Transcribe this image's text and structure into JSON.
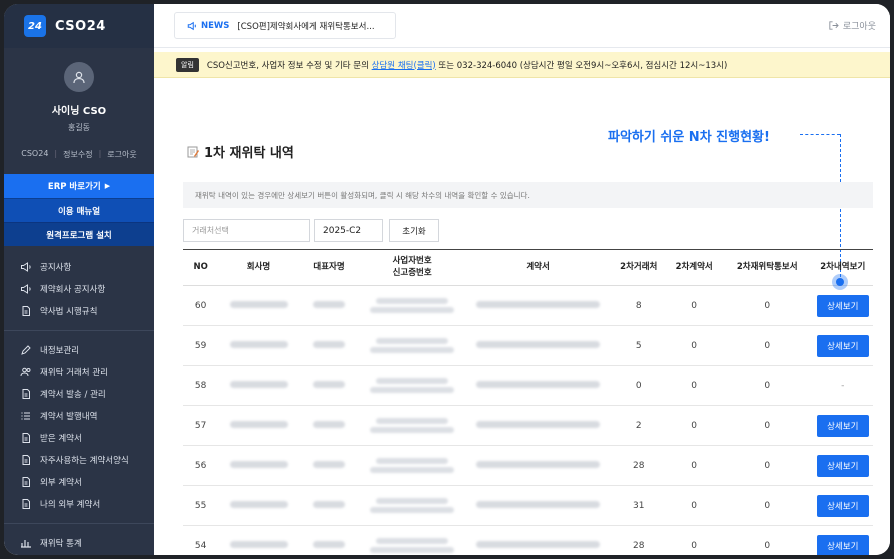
{
  "brand": {
    "logo": "24",
    "name": "CSO24"
  },
  "profile": {
    "name": "사이닝 CSO",
    "sub": "홍길동",
    "links": [
      "CSO24",
      "정보수정",
      "로그아웃"
    ]
  },
  "sidebar_buttons": {
    "erp": "ERP 바로가기",
    "manual": "이용 매뉴얼",
    "remote": "원격프로그램 설치"
  },
  "menu_group1": [
    {
      "label": "공지사항",
      "icon": "megaphone-icon"
    },
    {
      "label": "제약회사 공지사항",
      "icon": "megaphone-icon"
    },
    {
      "label": "약사법 시행규칙",
      "icon": "document-icon"
    }
  ],
  "menu_group2": [
    {
      "label": "내정보관리",
      "icon": "pencil-icon"
    },
    {
      "label": "재위탁 거래처 관리",
      "icon": "users-icon"
    },
    {
      "label": "계약서 발송 / 관리",
      "icon": "document-icon"
    },
    {
      "label": "계약서 발행내역",
      "icon": "list-icon"
    },
    {
      "label": "받은 계약서",
      "icon": "document-icon"
    },
    {
      "label": "자주사용하는 계약서양식",
      "icon": "document-icon"
    },
    {
      "label": "외부 계약서",
      "icon": "document-icon"
    },
    {
      "label": "나의 외부 계약서",
      "icon": "document-icon"
    }
  ],
  "menu_group3": [
    {
      "label": "재위탁 통계",
      "icon": "chart-icon"
    }
  ],
  "topbar": {
    "news_tag": "NEWS",
    "news_text": "[CSO편]제약회사에게 재위탁통보서...",
    "logout": "로그아웃"
  },
  "notice": {
    "badge": "알림",
    "text_before": "CSO신고번호, 사업자 정보 수정 및 기타 문의 ",
    "link": "상담원 채팅(클릭)",
    "text_after": " 또는 032-324-6040 (상담시간 평일 오전9시~오후6시, 점심시간 12시~13시)"
  },
  "callout": "파악하기 쉬운 N차 진행현황!",
  "page": {
    "title": "1차 재위탁 내역",
    "description": "재위탁 내역이 있는 경우에만 상세보기 버튼이 활성화되며, 클릭 시 해당 차수의 내역을 확인할 수 있습니다.",
    "filter_select_placeholder": "거래처선택",
    "filter_year": "2025-C2",
    "reset_label": "초기화"
  },
  "table": {
    "headers": {
      "no": "NO",
      "company": "회사명",
      "rep": "대표자명",
      "biz_line1": "사업자번호",
      "biz_line2": "신고증번호",
      "contract": "계약서",
      "n2_clients": "2차거래처",
      "n2_contracts": "2차계약서",
      "n2_notices": "2차재위탁통보서",
      "n2_view": "2차내역보기"
    },
    "rows": [
      {
        "no": "60",
        "clients": "8",
        "contracts": "0",
        "notices": "0",
        "view": "상세보기"
      },
      {
        "no": "59",
        "clients": "5",
        "contracts": "0",
        "notices": "0",
        "view": "상세보기"
      },
      {
        "no": "58",
        "clients": "0",
        "contracts": "0",
        "notices": "0",
        "view": "-"
      },
      {
        "no": "57",
        "clients": "2",
        "contracts": "0",
        "notices": "0",
        "view": "상세보기"
      },
      {
        "no": "56",
        "clients": "28",
        "contracts": "0",
        "notices": "0",
        "view": "상세보기"
      },
      {
        "no": "55",
        "clients": "31",
        "contracts": "0",
        "notices": "0",
        "view": "상세보기"
      },
      {
        "no": "54",
        "clients": "28",
        "contracts": "0",
        "notices": "0",
        "view": "상세보기"
      }
    ]
  },
  "colors": {
    "accent": "#1a6ff0",
    "sidebar": "#2b3446",
    "notice_bg": "#fdf6cc"
  }
}
